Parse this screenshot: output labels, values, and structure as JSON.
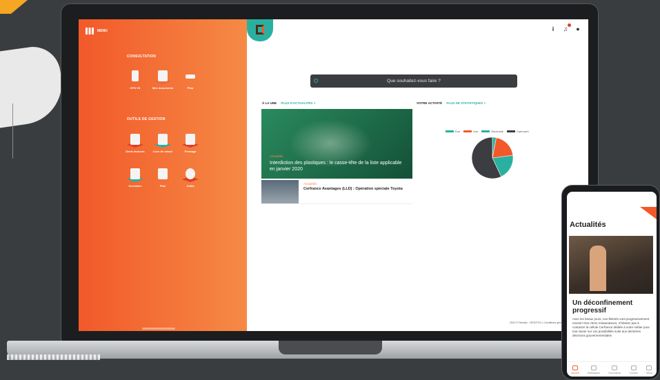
{
  "app": {
    "menu_label": "MENU"
  },
  "sidebar": {
    "consultation_title": "CONSULTATION",
    "consultation_items": [
      {
        "label": "GPS VS"
      },
      {
        "label": "Mes documents"
      },
      {
        "label": "Plus"
      }
    ],
    "tools_title": "OUTILS DE GESTION",
    "tools_items": [
      {
        "label": "Devis factures"
      },
      {
        "label": "Livre de caisse"
      },
      {
        "label": "Fermage"
      },
      {
        "label": "Inventaire"
      },
      {
        "label": "Paie"
      },
      {
        "label": "Outils"
      }
    ]
  },
  "topbar": {
    "info_icon": "info-icon",
    "notification_icon": "bell-icon",
    "user_icon": "user-icon"
  },
  "search": {
    "placeholder": "Que souhaitez-vous faire ?"
  },
  "news": {
    "heading": "À LA UNE",
    "more_link": "PLUS D'ACTUALITÉS >",
    "featured": {
      "tag": "Actualités",
      "title": "Interdiction des plastiques : le casse-tête de la liste applicable en janvier 2020"
    },
    "second": {
      "tag": "Actualités",
      "title": "Cerfrance Avantages (LLD) : Opération spéciale Toyota"
    }
  },
  "stats": {
    "heading": "VOTRE ACTIVITÉ",
    "more_link": "PLUS DE STATISTIQUES >"
  },
  "chart_data": {
    "type": "pie",
    "categories": [
      "Eau",
      "Gaz",
      "Electricité",
      "Carburant"
    ],
    "values": [
      3,
      20,
      20,
      57
    ],
    "colors": [
      "#2ab0a0",
      "#f2592a",
      "#2ab0a0",
      "#3b3d40"
    ],
    "legend_placement": "top"
  },
  "footer": {
    "text": "2020 © Resotic - RESOTIC | Conditions générales | Plan du site"
  },
  "phone": {
    "title": "Actualités",
    "card_title": "Un déconfinement progressif",
    "card_text": "Avec les beaux jours, nos libertés vont progressivement revenir! Nos chers restaurateurs, n'hésitez pas à contacter la cellule Cerfrance dédiée à votre métier pour tout savoir sur vos possibilités suite aux dernières décisions gouvernementales",
    "nav": [
      {
        "label": "Accueil"
      },
      {
        "label": "Statistiques"
      },
      {
        "label": "Documents"
      },
      {
        "label": "Contact"
      },
      {
        "label": "Menu"
      }
    ]
  }
}
